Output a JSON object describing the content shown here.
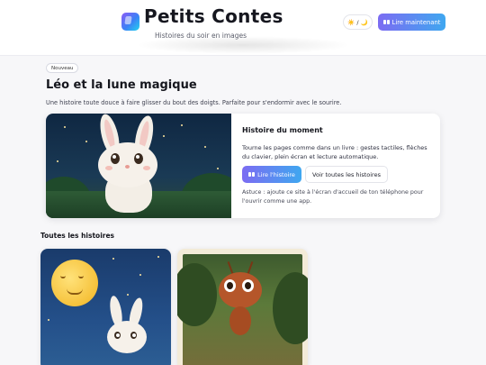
{
  "header": {
    "brand_title": "Petits Contes",
    "brand_subtitle": "Histoires du soir en images",
    "theme_toggle_label": "☀️ / 🌙",
    "read_now_label": "Lire maintenant"
  },
  "hero": {
    "badge": "Nouveau",
    "title": "Léo et la lune magique",
    "description": "Une histoire toute douce à faire glisser du bout des doigts. Parfaite pour s'endormir avec le sourire."
  },
  "feature": {
    "heading": "Histoire du moment",
    "text": "Tourne les pages comme dans un livre : gestes tactiles, flèches du clavier, plein écran et lecture automatique.",
    "read_button": "Lire l'histoire",
    "all_button": "Voir toutes les histoires",
    "tip": "Astuce : ajoute ce site à l'écran d'accueil de ton téléphone pour l'ouvrir comme une app."
  },
  "grid": {
    "section_title": "Toutes les histoires"
  },
  "colors": {
    "accent_start": "#7c6cf2",
    "accent_end": "#3fa7f0"
  }
}
